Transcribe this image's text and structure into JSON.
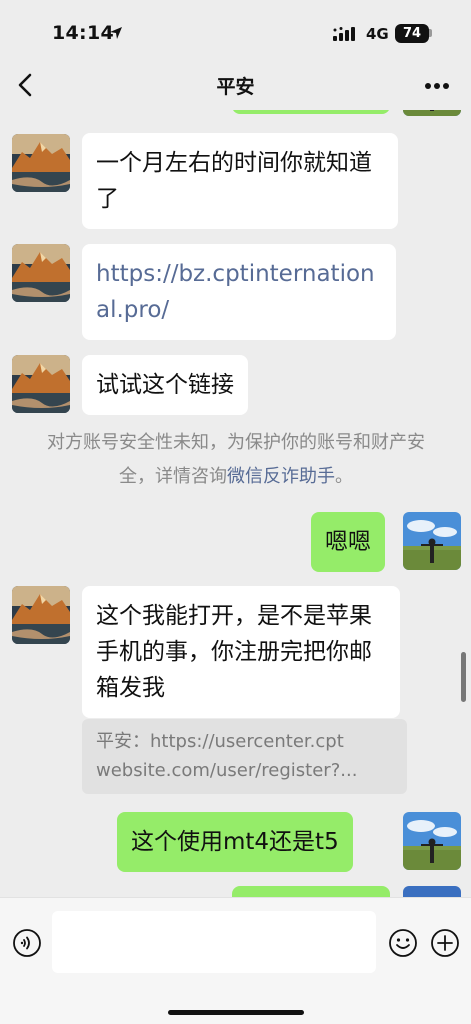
{
  "status_bar": {
    "time": "14:14",
    "network": "4G",
    "battery": "74"
  },
  "nav": {
    "title": "平安"
  },
  "messages": [
    {
      "side": "in",
      "text": "一个月左右的时间你就知道了"
    },
    {
      "side": "in",
      "text": "https://bz.cptinternational.pro/",
      "is_link": true
    },
    {
      "side": "in",
      "text": "试试这个链接"
    },
    {
      "side": "out",
      "text": "嗯嗯"
    },
    {
      "side": "in",
      "text": "这个我能打开，是不是苹果手机的事，你注册完把你邮箱发我"
    },
    {
      "side": "out",
      "text": "这个使用mt4还是t5"
    }
  ],
  "notice": {
    "text": "对方账号安全性未知，为保护你的账号和财产安全，详情咨询",
    "link": "微信反诈助手",
    "end": "。"
  },
  "quote": {
    "line1": "平安：https://usercenter.cpt",
    "line2": "website.com/user/register?..."
  },
  "colors": {
    "background": "#ededed",
    "incoming_bubble": "#ffffff",
    "outgoing_bubble": "#95ec69",
    "link": "#576b95"
  },
  "icons": [
    "back-icon",
    "more-icon",
    "voice-icon",
    "emoji-icon",
    "plus-icon",
    "location-arrow-icon",
    "signal-icon",
    "battery-icon"
  ]
}
